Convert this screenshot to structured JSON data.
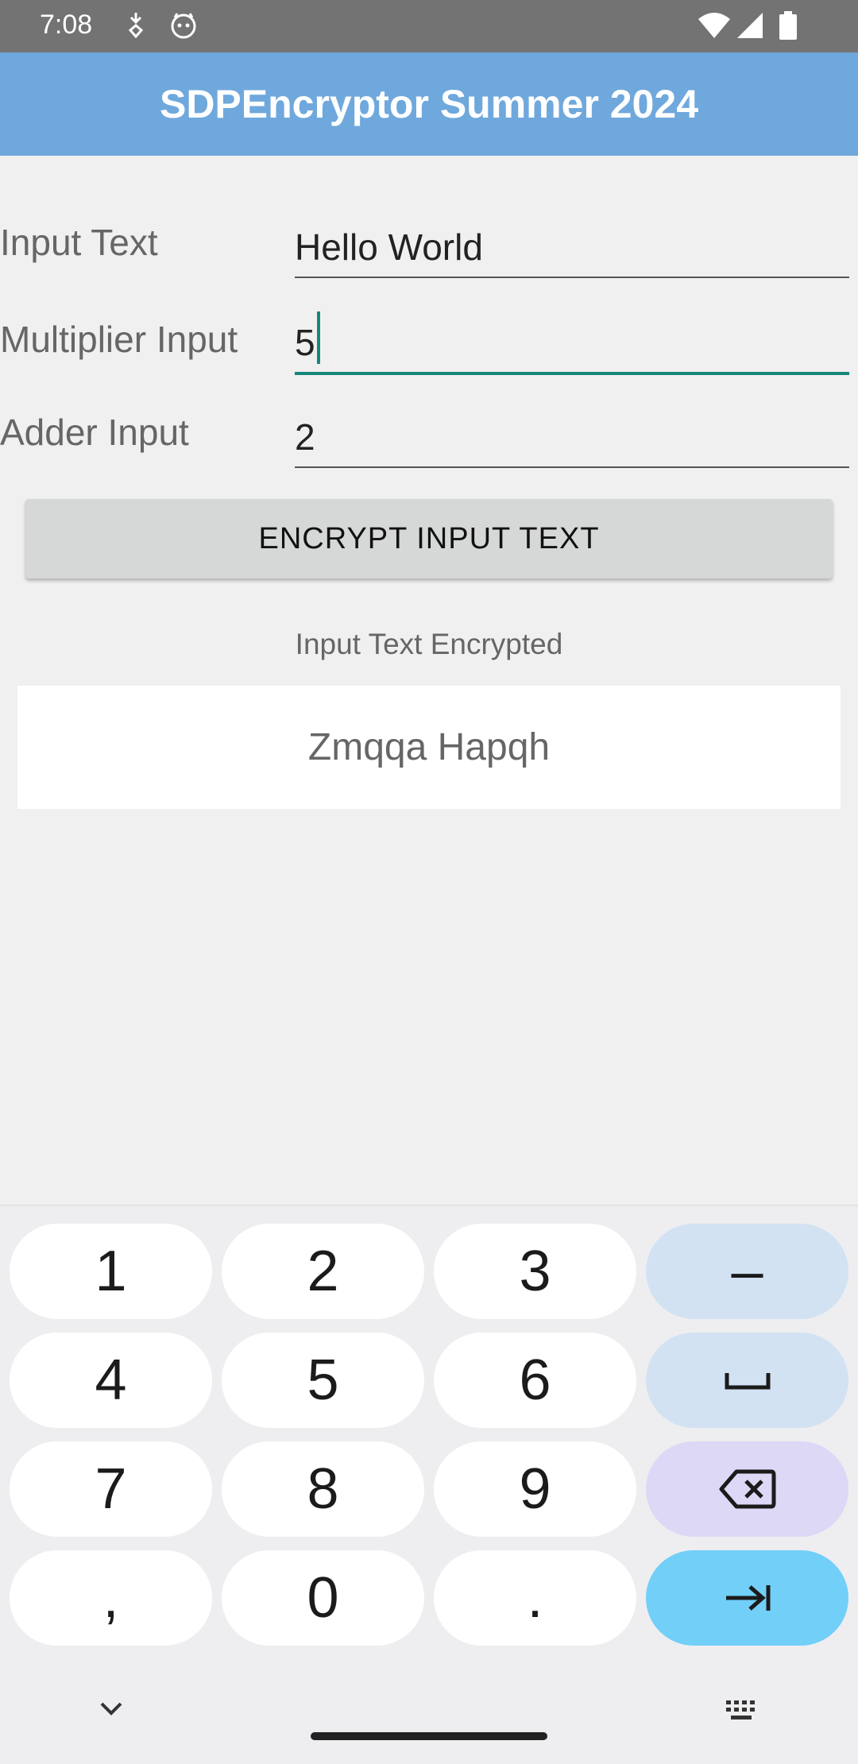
{
  "status_bar": {
    "time": "7:08",
    "icons": [
      "cellular-transfer-icon",
      "app-notification-icon",
      "wifi-icon",
      "signal-icon",
      "battery-icon"
    ]
  },
  "app_bar": {
    "title": "SDPEncryptor Summer 2024",
    "color": "#6fa8dc"
  },
  "form": {
    "input_text": {
      "label": "Input Text",
      "value": "Hello World"
    },
    "multiplier": {
      "label": "Multiplier Input",
      "value": "5"
    },
    "adder": {
      "label": "Adder Input",
      "value": "2"
    },
    "encrypt_button": "ENCRYPT INPUT TEXT",
    "result_label": "Input Text Encrypted",
    "result_value": "Zmqqa Hapqh"
  },
  "keyboard": {
    "keys": {
      "k1": "1",
      "k2": "2",
      "k3": "3",
      "minus": "–",
      "k4": "4",
      "k5": "5",
      "k6": "6",
      "k7": "7",
      "k8": "8",
      "k9": "9",
      "comma": ",",
      "k0": "0",
      "period": "."
    },
    "colors": {
      "function_key": "#d2e2f3",
      "delete_key": "#dcd8f6",
      "action_key": "#72cff8"
    }
  }
}
